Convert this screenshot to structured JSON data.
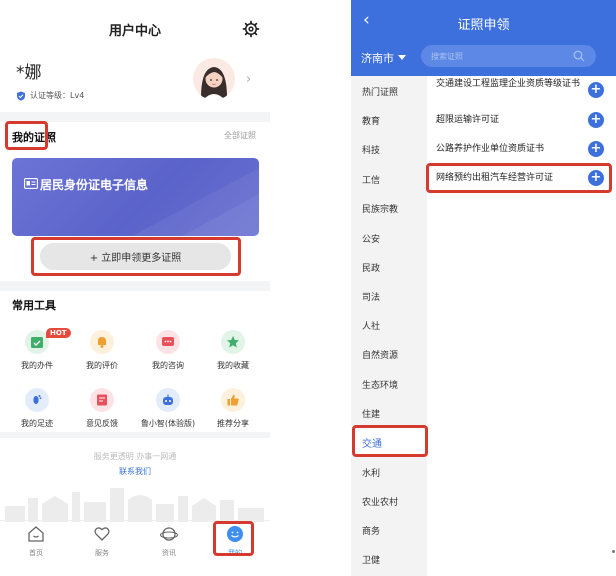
{
  "left": {
    "header": {
      "title": "用户中心",
      "settings_icon": "gear-icon"
    },
    "profile": {
      "name": "*娜",
      "verify_label": "认证等级：Lv4"
    },
    "my_certs": {
      "title": "我的证照",
      "all_link": "全部证照",
      "card_title": "居民身份证电子信息",
      "apply_button": "+ 立即申领更多证照"
    },
    "tools": {
      "title": "常用工具",
      "hot_badge": "HOT",
      "items": [
        {
          "label": "我的办件",
          "icon": "calendar-check-icon",
          "color": "#3fae6a"
        },
        {
          "label": "我的评价",
          "icon": "bell-icon",
          "color": "#f0a030"
        },
        {
          "label": "我的咨询",
          "icon": "chat-icon",
          "color": "#e8505b"
        },
        {
          "label": "我的收藏",
          "icon": "star-icon",
          "color": "#3fae6a"
        },
        {
          "label": "我的足迹",
          "icon": "footprint-icon",
          "color": "#3d70dd"
        },
        {
          "label": "意见反馈",
          "icon": "feedback-icon",
          "color": "#e8505b"
        },
        {
          "label": "鲁小智(体验版)",
          "icon": "robot-icon",
          "color": "#3d70dd"
        },
        {
          "label": "推荐分享",
          "icon": "thumbs-up-icon",
          "color": "#f0a030"
        }
      ]
    },
    "footer": {
      "slogan": "服务更透明 办事一网通",
      "contact": "联系我们"
    },
    "tabbar": [
      {
        "label": "首页",
        "icon": "home-icon"
      },
      {
        "label": "服务",
        "icon": "heart-icon"
      },
      {
        "label": "资讯",
        "icon": "planet-icon"
      },
      {
        "label": "我的",
        "icon": "smile-icon",
        "active": true
      }
    ]
  },
  "right": {
    "header": {
      "title": "证照申领",
      "back_icon": "back-arrow-icon"
    },
    "city": "济南市",
    "search_placeholder": "搜索证照",
    "categories": [
      "热门证照",
      "教育",
      "科技",
      "工信",
      "民族宗教",
      "公安",
      "民政",
      "司法",
      "人社",
      "自然资源",
      "生态环境",
      "住建",
      "交通",
      "水利",
      "农业农村",
      "商务",
      "卫健"
    ],
    "active_category": "交通",
    "items": [
      "交通建设工程监理企业资质等级证书",
      "超限运输许可证",
      "公路养护作业单位资质证书",
      "网络预约出租汽车经营许可证"
    ]
  },
  "colors": {
    "accent": "#3d70dd",
    "highlight": "#d63a2f",
    "card": "#5f68cf"
  }
}
